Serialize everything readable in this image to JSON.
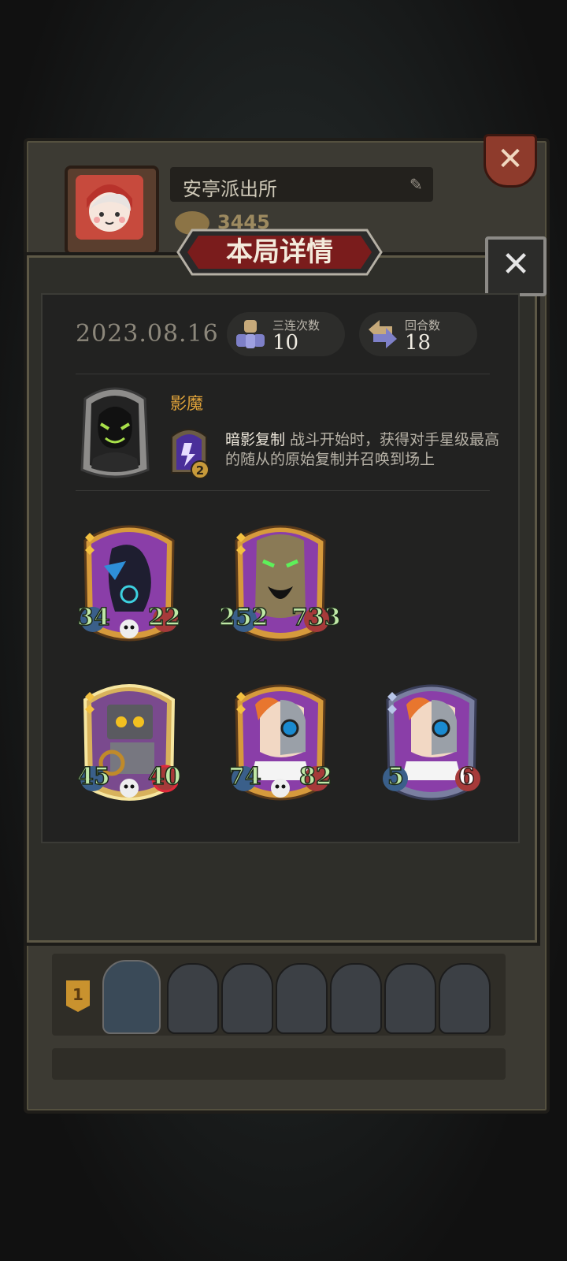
{
  "profile": {
    "player_name": "安亭派出所",
    "coins": "3445"
  },
  "detail": {
    "title": "本局详情",
    "date": "2023.08.16",
    "triple_label": "三连次数",
    "triple_value": "10",
    "rounds_label": "回合数",
    "rounds_value": "18"
  },
  "hero": {
    "name": "影魔",
    "skill_level": "2",
    "skill_name": "暗影复制",
    "skill_desc": " 战斗开始时，获得对手星级最高的随从的原始复制并召唤到场上"
  },
  "minions": [
    {
      "attack": "34",
      "health": "22",
      "icon": "crow-mage-icon"
    },
    {
      "attack": "252",
      "health": "733",
      "icon": "treant-icon"
    },
    {
      "attack": "45",
      "health": "40",
      "icon": "robot-box-icon"
    },
    {
      "attack": "74",
      "health": "82",
      "icon": "cyborg-doctor-icon"
    },
    {
      "attack": "5",
      "health": "6",
      "icon": "cyborg-doctor-icon"
    }
  ],
  "footer": {
    "rank": "1"
  },
  "colors": {
    "accent_orange": "#e0a33a",
    "stat_green": "#bfe8a6",
    "title_red": "#7a1c1c"
  }
}
